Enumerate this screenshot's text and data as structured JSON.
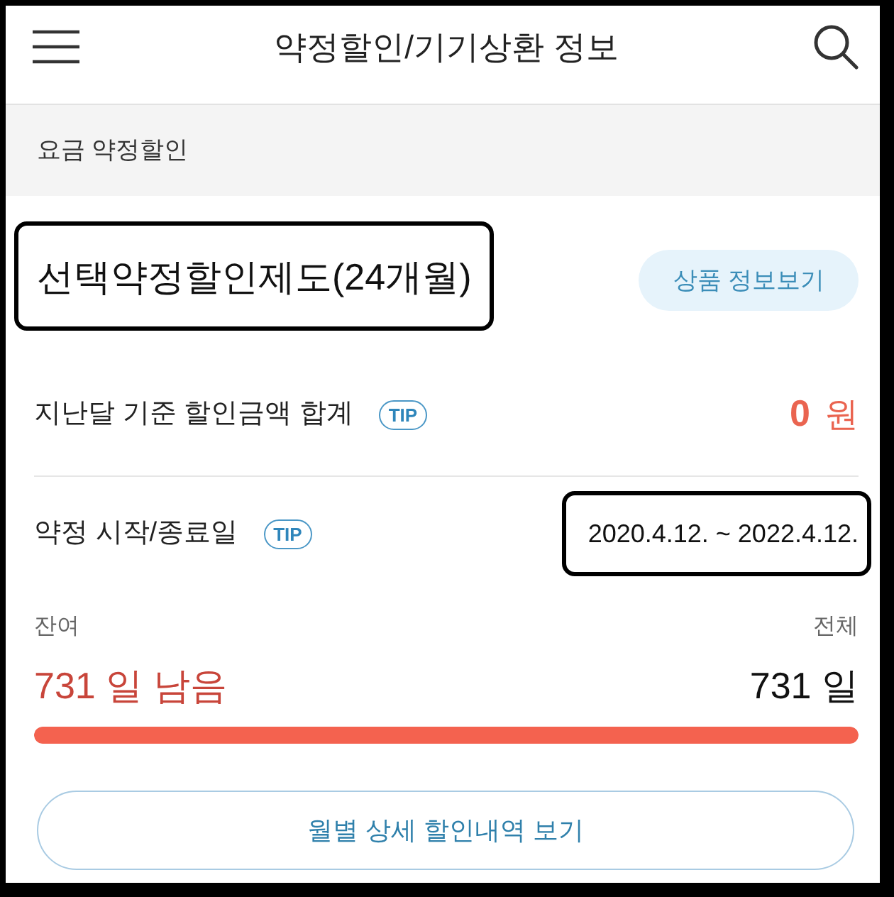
{
  "header": {
    "title": "약정할인/기기상환 정보"
  },
  "section": {
    "title": "요금 약정할인"
  },
  "plan": {
    "name": "선택약정할인제도(24개월)",
    "highlighted": true,
    "button": "상품 정보보기"
  },
  "rows": [
    {
      "kind": "amount",
      "label": "지난달 기준 할인금액 합계",
      "tip": "TIP",
      "value": "0",
      "unit": "원",
      "highlighted": false
    },
    {
      "kind": "date",
      "label": "약정 시작/종료일",
      "tip": "TIP",
      "value": "2020.4.12. ~ 2022.4.12.",
      "highlighted": true
    }
  ],
  "period": {
    "remaining_label": "잔여",
    "total_label": "전체",
    "remaining": "731 일 남음",
    "total": "731 일",
    "level": 1
  },
  "detail_button": "월별 상세 할인내역 보기"
}
